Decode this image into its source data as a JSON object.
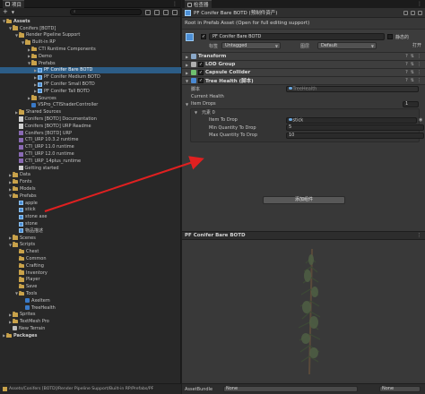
{
  "project": {
    "tab_label": "项目",
    "search_placeholder": "",
    "add_label": "+",
    "tree": [
      {
        "label": "Assets",
        "depth": 0,
        "kind": "folder",
        "arrow": "▼",
        "bold": true
      },
      {
        "label": "Conifers [BOTD]",
        "depth": 1,
        "kind": "folder",
        "arrow": "▼"
      },
      {
        "label": "Render Pipeline Support",
        "depth": 2,
        "kind": "folder",
        "arrow": "▼"
      },
      {
        "label": "Built-in RP",
        "depth": 3,
        "kind": "folder",
        "arrow": "▼"
      },
      {
        "label": "CTI Runtime Components",
        "depth": 4,
        "kind": "folder",
        "arrow": "▶"
      },
      {
        "label": "Demo",
        "depth": 4,
        "kind": "folder",
        "arrow": "▶"
      },
      {
        "label": "Prefabs",
        "depth": 4,
        "kind": "folder",
        "arrow": "▼"
      },
      {
        "label": "PF Conifer Bare BOTD",
        "depth": 5,
        "kind": "prefab",
        "arrow": "▶",
        "selected": true
      },
      {
        "label": "PF Conifer Medium BOTD",
        "depth": 5,
        "kind": "prefab",
        "arrow": "▶"
      },
      {
        "label": "PF Conifer Small BOTD",
        "depth": 5,
        "kind": "prefab",
        "arrow": "▶"
      },
      {
        "label": "PF Conifer Tall BOTD",
        "depth": 5,
        "kind": "prefab",
        "arrow": "▶"
      },
      {
        "label": "Sources",
        "depth": 4,
        "kind": "folder",
        "arrow": "▶"
      },
      {
        "label": "VSPro_CTIShaderController",
        "depth": 4,
        "kind": "script",
        "arrow": ""
      },
      {
        "label": "Shared Sources",
        "depth": 2,
        "kind": "folder",
        "arrow": "▶"
      },
      {
        "label": "Conifers [BOTD] Documentation",
        "depth": 2,
        "kind": "doc",
        "arrow": ""
      },
      {
        "label": "Conifers [BOTD] URP Readme",
        "depth": 2,
        "kind": "doc",
        "arrow": ""
      },
      {
        "label": "Conifers [BOTD] URP",
        "depth": 2,
        "kind": "pkg",
        "arrow": ""
      },
      {
        "label": "CTI_URP 10.3.2 runtime",
        "depth": 2,
        "kind": "pkg",
        "arrow": ""
      },
      {
        "label": "CTI_URP 11.0 runtime",
        "depth": 2,
        "kind": "pkg",
        "arrow": ""
      },
      {
        "label": "CTI_URP 12.0 runtime",
        "depth": 2,
        "kind": "pkg",
        "arrow": ""
      },
      {
        "label": "CTI_URP_14plus_runtime",
        "depth": 2,
        "kind": "pkg",
        "arrow": ""
      },
      {
        "label": "Getting started",
        "depth": 2,
        "kind": "doc",
        "arrow": ""
      },
      {
        "label": "Data",
        "depth": 1,
        "kind": "folder",
        "arrow": "▶"
      },
      {
        "label": "Fonts",
        "depth": 1,
        "kind": "folder",
        "arrow": "▶"
      },
      {
        "label": "Models",
        "depth": 1,
        "kind": "folder",
        "arrow": "▶"
      },
      {
        "label": "Prefabs",
        "depth": 1,
        "kind": "folder",
        "arrow": "▼"
      },
      {
        "label": "apple",
        "depth": 2,
        "kind": "prefab",
        "arrow": ""
      },
      {
        "label": "stick",
        "depth": 2,
        "kind": "prefab",
        "arrow": ""
      },
      {
        "label": "stone axe",
        "depth": 2,
        "kind": "prefab",
        "arrow": ""
      },
      {
        "label": "stone",
        "depth": 2,
        "kind": "prefab",
        "arrow": ""
      },
      {
        "label": "物品描述",
        "depth": 2,
        "kind": "prefab",
        "arrow": ""
      },
      {
        "label": "Scenes",
        "depth": 1,
        "kind": "folder",
        "arrow": "▶"
      },
      {
        "label": "Scripts",
        "depth": 1,
        "kind": "folder",
        "arrow": "▼"
      },
      {
        "label": "Chest",
        "depth": 2,
        "kind": "folder",
        "arrow": ""
      },
      {
        "label": "Common",
        "depth": 2,
        "kind": "folder",
        "arrow": ""
      },
      {
        "label": "Crafting",
        "depth": 2,
        "kind": "folder",
        "arrow": ""
      },
      {
        "label": "Inventory",
        "depth": 2,
        "kind": "folder",
        "arrow": ""
      },
      {
        "label": "Player",
        "depth": 2,
        "kind": "folder",
        "arrow": ""
      },
      {
        "label": "Save",
        "depth": 2,
        "kind": "folder",
        "arrow": ""
      },
      {
        "label": "Tools",
        "depth": 2,
        "kind": "folder",
        "arrow": "▼"
      },
      {
        "label": "AxeItem",
        "depth": 3,
        "kind": "script",
        "arrow": ""
      },
      {
        "label": "TreeHealth",
        "depth": 3,
        "kind": "script",
        "arrow": ""
      },
      {
        "label": "Sprites",
        "depth": 1,
        "kind": "folder",
        "arrow": "▶"
      },
      {
        "label": "TextMesh Pro",
        "depth": 1,
        "kind": "folder",
        "arrow": "▶"
      },
      {
        "label": "New Terrain",
        "depth": 1,
        "kind": "scene",
        "arrow": ""
      },
      {
        "label": "Packages",
        "depth": 0,
        "kind": "folder",
        "arrow": "▶",
        "bold": true
      }
    ],
    "status_path": "Assets/Conifers [BOTD]/Render Pipeline Support/Built-in RP/Prefabs/PF"
  },
  "inspector": {
    "tab_label": "检查器",
    "asset_title": "PF Conifer Bare BOTD (预制件资产)",
    "readonly_notice": "Root in Prefab Asset (Open for full editing support)",
    "gameobject": {
      "name": "PF Conifer Bare BOTD",
      "static_label": "静态的",
      "tag_label": "标签",
      "tag_value": "Untagged",
      "layer_label": "图层",
      "layer_value": "Default",
      "open_label": "打开"
    },
    "components": [
      {
        "name": "Transform",
        "checkbox": false,
        "icon_color": "#8aa8c8"
      },
      {
        "name": "LOD Group",
        "checkbox": true,
        "icon_color": "#b0b0b0"
      },
      {
        "name": "Capsule Collider",
        "checkbox": true,
        "icon_color": "#6fbf6f"
      },
      {
        "name": "Tree Health (脚本)",
        "checkbox": true,
        "icon_color": "#4a8ad4"
      }
    ],
    "tree_health": {
      "script_label": "脚本",
      "script_value": "TreeHealth",
      "current_health_label": "Current Health",
      "current_health_value": "",
      "item_drops_label": "Item Drops",
      "item_drops_count": "1",
      "element_label": "元素 0",
      "item_to_drop_label": "Item To Drop",
      "item_to_drop_value": "stick",
      "min_qty_label": "Min Quantity To Drop",
      "min_qty_value": "5",
      "max_qty_label": "Max Quantity To Drop",
      "max_qty_value": "10"
    },
    "add_component_label": "添加组件",
    "preview_title": "PF Conifer Bare BOTD",
    "assetbundle_label": "AssetBundle",
    "assetbundle_value": "None",
    "assetbundle_variant": "None"
  }
}
